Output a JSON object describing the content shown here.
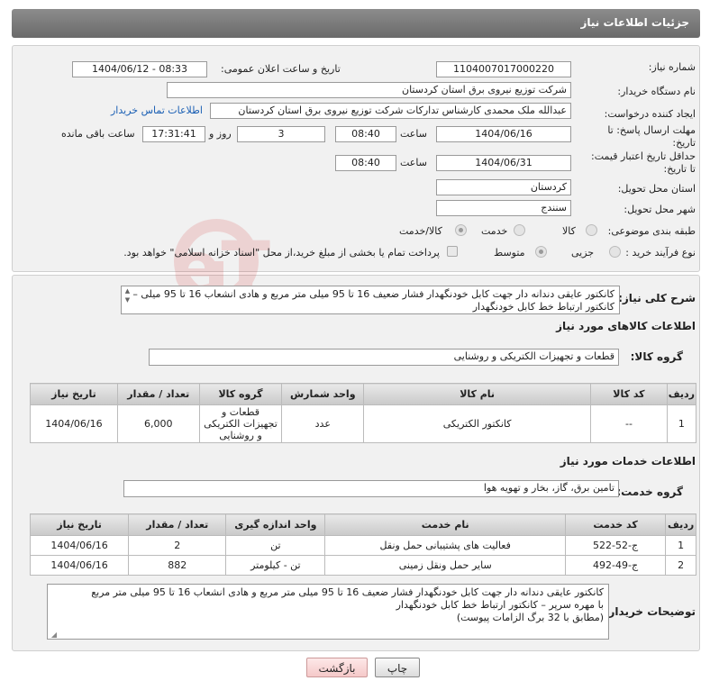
{
  "header": {
    "title": "جزئیات اطلاعات نیاز"
  },
  "fields": {
    "need_number_label": "شماره نیاز:",
    "need_number": "1104007017000220",
    "announce_label": "تاریخ و ساعت اعلان عمومی:",
    "announce_value": "1404/06/12 - 08:33",
    "buyer_label": "نام دستگاه خریدار:",
    "buyer_value": "شرکت توزیع نیروی برق استان کردستان",
    "creator_label": "ایجاد کننده درخواست:",
    "creator_value": "عبدالله ملک محمدی کارشناس تدارکات شرکت توزیع نیروی برق استان کردستان",
    "contact_link": "اطلاعات تماس خریدار",
    "deadline_label_1": "مهلت ارسال پاسخ: تا",
    "deadline_label_2": "تاریخ:",
    "deadline_date": "1404/06/16",
    "time_label": "ساعت",
    "deadline_time": "08:40",
    "days_value": "3",
    "days_label": "روز و",
    "remaining_time": "17:31:41",
    "remaining_label": "ساعت باقی مانده",
    "validity_label_1": "حداقل تاریخ اعتبار قیمت:",
    "validity_label_2": "تا تاریخ:",
    "validity_date": "1404/06/31",
    "validity_time": "08:40",
    "province_label": "استان محل تحویل:",
    "province_value": "کردستان",
    "city_label": "شهر محل تحویل:",
    "city_value": "سنندج",
    "category_label": "طبقه بندی موضوعی:",
    "category_options": [
      "کالا",
      "خدمت",
      "کالا/خدمت"
    ],
    "process_label": "نوع فرآیند خرید :",
    "process_options": [
      "جزیی",
      "متوسط"
    ],
    "payment_note": "پرداخت تمام یا بخشی از مبلغ خرید،از محل \"اسناد خزانه اسلامی\" خواهد بود."
  },
  "description": {
    "label": "شرح کلی نیاز:",
    "text": "کانکتور عایقی دندانه دار جهت کابل خودنگهدار فشار ضعیف 16 تا 95 میلی متر مربع و هادی انشعاب 16 تا 95 میلی – کانکتور ارتباط خط کابل خودنگهدار"
  },
  "goods": {
    "section_title": "اطلاعات کالاهای مورد نیاز",
    "group_label": "گروه کالا:",
    "group_value": "قطعات و تجهیزات الکتریکی و روشنایی",
    "columns": [
      "ردیف",
      "کد کالا",
      "نام کالا",
      "واحد شمارش",
      "گروه کالا",
      "تعداد / مقدار",
      "تاریخ نیاز"
    ],
    "rows": [
      {
        "row": "1",
        "code": "--",
        "name": "کانکتور الکتریکی",
        "unit": "عدد",
        "group": "قطعات و تجهیزات الکتریکی و روشنایی",
        "qty": "6,000",
        "date": "1404/06/16"
      }
    ]
  },
  "services": {
    "section_title": "اطلاعات خدمات مورد نیاز",
    "group_label": "گروه خدمت:",
    "group_value": "تامین برق، گاز، بخار و تهویه هوا",
    "columns": [
      "ردیف",
      "کد خدمت",
      "نام خدمت",
      "واحد اندازه گیری",
      "تعداد / مقدار",
      "تاریخ نیاز"
    ],
    "rows": [
      {
        "row": "1",
        "code": "ج-52-522",
        "name": "فعالیت های پشتیبانی حمل ونقل",
        "unit": "تن",
        "qty": "2",
        "date": "1404/06/16"
      },
      {
        "row": "2",
        "code": "ج-49-492",
        "name": "سایر حمل ونقل زمینی",
        "unit": "تن - کیلومتر",
        "qty": "882",
        "date": "1404/06/16"
      }
    ]
  },
  "buyer_notes": {
    "label": "توضیحات خریدار:",
    "line1": "کانکتور عایقی دندانه دار جهت کابل خودنگهدار فشار ضعیف 16 تا 95 میلی متر مربع و هادی انشعاب 16 تا 95 میلی متر مربع",
    "line2": "با مهره سرپر – کانکتور ارتباط خط کابل خودنگهدار",
    "line3": "(مطابق با 32 برگ الزامات پیوست)"
  },
  "buttons": {
    "print": "چاپ",
    "back": "بازگشت"
  },
  "icons": {
    "spinner": "scroll-spinner-icon",
    "resize": "resize-grip-icon",
    "watermark": "ariatender-watermark"
  }
}
